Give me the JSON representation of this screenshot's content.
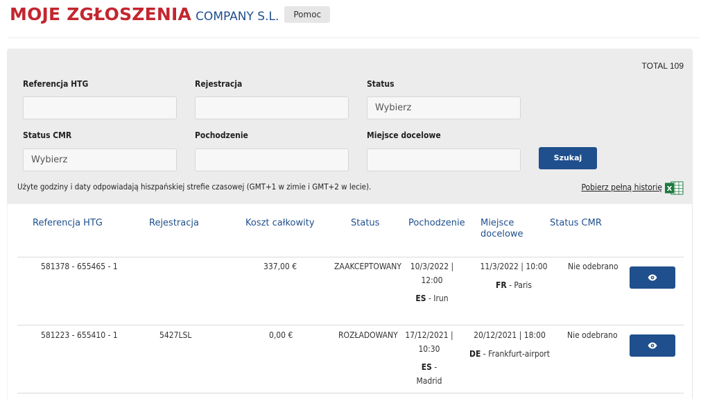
{
  "header": {
    "title": "MOJE ZGŁOSZENIA",
    "company": "COMPANY S.L.",
    "help_label": "Pomoc"
  },
  "filters": {
    "total": "TOTAL 109",
    "ref_label": "Referencja HTG",
    "ref_value": "",
    "registration_label": "Rejestracja",
    "registration_value": "",
    "status_label": "Status",
    "status_placeholder": "Wybierz",
    "cmr_label": "Status CMR",
    "cmr_placeholder": "Wybierz",
    "origin_label": "Pochodzenie",
    "origin_value": "",
    "destination_label": "Miejsce docelowe",
    "destination_value": "",
    "search_label": "Szukaj",
    "timezone_note": "Użyte godziny i daty odpowiadają hiszpańskiej strefie czasowej (GMT+1 w zimie i GMT+2 w lecie).",
    "download_label": "Pobierz pełną historię",
    "excel_icon": "excel-icon"
  },
  "table": {
    "columns": [
      "Referencja HTG",
      "Rejestracja",
      "Koszt całkowity",
      "Status",
      "Pochodzenie",
      "Miejsce\ndocelowe",
      "Status CMR"
    ],
    "rows": [
      {
        "reference": "581378 - 655465 - 1",
        "registration": "",
        "cost": "337,00 €",
        "status": "ZAAKCEPTOWANY",
        "origin_date": "10/3/2022 |",
        "origin_time": "12:00",
        "origin_country": "ES",
        "origin_city": " - Irun",
        "dest_datetime": "11/3/2022 | 10:00",
        "dest_country": "FR",
        "dest_city": " - Paris",
        "cmr_status": "Nie odebrano",
        "action_icon": "eye-icon"
      },
      {
        "reference": "581223 - 655410 - 1",
        "registration": "5427LSL",
        "cost": "0,00 €",
        "status": "ROZŁADOWANY",
        "origin_date": "17/12/2021 |",
        "origin_time": "10:30",
        "origin_country": "ES",
        "origin_city": " -",
        "origin_city2": "Madrid",
        "dest_datetime": "20/12/2021 | 18:00",
        "dest_country": "DE",
        "dest_city": " - Frankfurt-airport",
        "cmr_status": "Nie odebrano",
        "action_icon": "eye-icon"
      }
    ]
  },
  "colors": {
    "brand_red": "#c3262f",
    "brand_blue": "#1f4f8c",
    "panel_gray": "#ececec"
  }
}
